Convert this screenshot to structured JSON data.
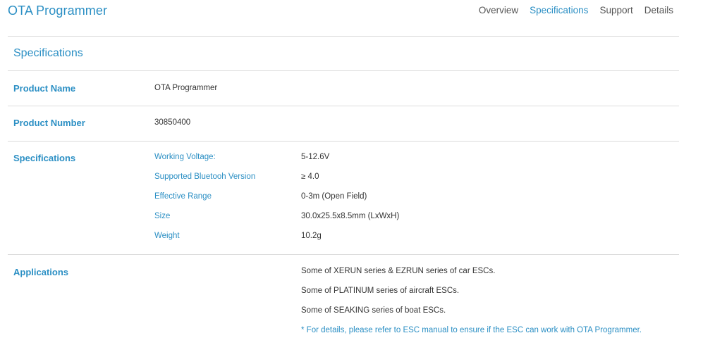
{
  "header": {
    "brand": "OTA Programmer",
    "nav": [
      {
        "label": "Overview"
      },
      {
        "label": "Specifications"
      },
      {
        "label": "Support"
      },
      {
        "label": "Details"
      }
    ]
  },
  "section_title": "Specifications",
  "rows": {
    "product_name": {
      "label": "Product Name",
      "value": "OTA Programmer"
    },
    "product_number": {
      "label": "Product Number",
      "value": "30850400"
    },
    "specifications": {
      "label": "Specifications"
    },
    "applications": {
      "label": "Applications"
    }
  },
  "specs": [
    {
      "key": "Working Voltage:",
      "value": "5-12.6V"
    },
    {
      "key": "Supported Bluetooh Version",
      "value": "≥ 4.0"
    },
    {
      "key": "Effective Range",
      "value": "0-3m (Open Field)"
    },
    {
      "key": "Size",
      "value": "30.0x25.5x8.5mm (LxWxH)"
    },
    {
      "key": "Weight",
      "value": "10.2g"
    }
  ],
  "applications": [
    "Some of XERUN series & EZRUN series of car ESCs.",
    "Some of PLATINUM series of aircraft ESCs.",
    "Some of SEAKING series of boat ESCs."
  ],
  "applications_note": "* For details, please refer to ESC manual to ensure if the ESC can work with OTA Programmer.",
  "colors": {
    "accent": "#2b8fc4",
    "text": "#333333",
    "divider": "#dcdcdc"
  }
}
